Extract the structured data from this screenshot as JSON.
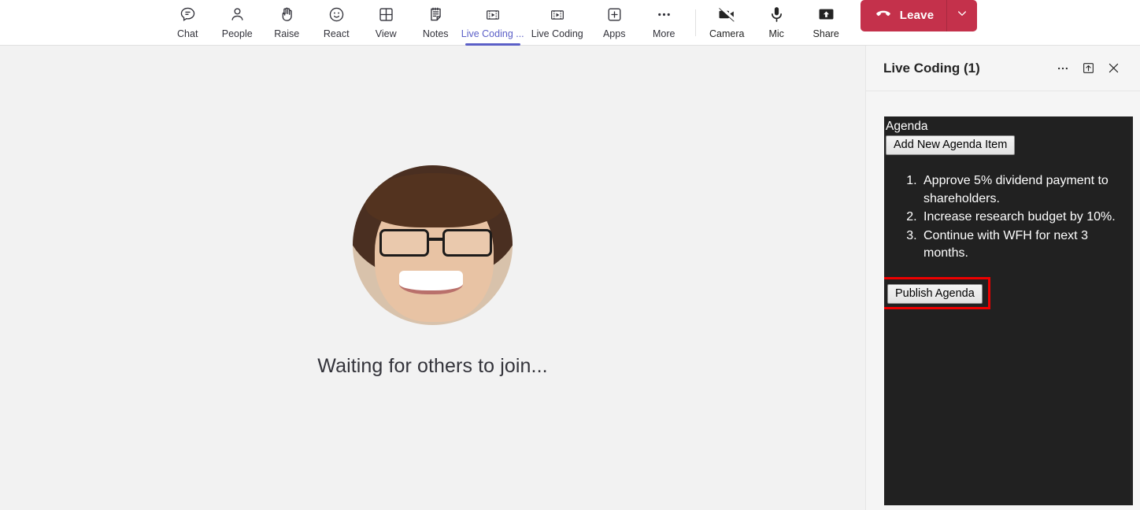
{
  "toolbar": {
    "items": [
      {
        "label": "Chat",
        "icon": "chat-icon",
        "active": false
      },
      {
        "label": "People",
        "icon": "people-icon",
        "active": false
      },
      {
        "label": "Raise",
        "icon": "raise-hand-icon",
        "active": false
      },
      {
        "label": "React",
        "icon": "react-emoji-icon",
        "active": false
      },
      {
        "label": "View",
        "icon": "view-grid-icon",
        "active": false
      },
      {
        "label": "Notes",
        "icon": "notes-icon",
        "active": false
      },
      {
        "label": "Live Coding ...",
        "icon": "live-coding-app-icon",
        "active": true
      },
      {
        "label": "Live Coding",
        "icon": "live-coding-app-icon",
        "active": false
      },
      {
        "label": "Apps",
        "icon": "apps-plus-icon",
        "active": false
      },
      {
        "label": "More",
        "icon": "more-ellipsis-icon",
        "active": false
      }
    ],
    "controls": [
      {
        "label": "Camera",
        "icon": "camera-off-icon"
      },
      {
        "label": "Mic",
        "icon": "microphone-icon"
      },
      {
        "label": "Share",
        "icon": "share-screen-icon"
      }
    ],
    "leave": {
      "label": "Leave",
      "icon": "hangup-phone-icon",
      "caret_icon": "chevron-down-icon",
      "color": "#c4314b"
    },
    "active_accent": "#5b5fc7"
  },
  "stage": {
    "avatar_name": "participant-avatar",
    "caption": "Waiting for others to join..."
  },
  "panel": {
    "title": "Live Coding (1)",
    "actions": [
      {
        "name": "more-options-icon",
        "glyph": "…"
      },
      {
        "name": "popout-icon",
        "glyph": "⬆"
      },
      {
        "name": "close-icon",
        "glyph": "✕"
      }
    ],
    "app": {
      "heading": "Agenda",
      "add_button": "Add New Agenda Item",
      "items": [
        "Approve 5% dividend payment to shareholders.",
        "Increase research budget by 10%.",
        "Continue with WFH for next 3 months."
      ],
      "publish_button": "Publish Agenda",
      "highlight_color": "#ee0000",
      "background": "#212121"
    }
  }
}
